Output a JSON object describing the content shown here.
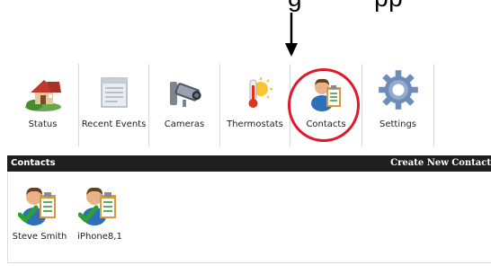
{
  "annotation": {
    "top_text_left": "g",
    "top_text_right": "pp"
  },
  "toolbar": {
    "items": [
      {
        "label": "Status",
        "icon": "house-icon"
      },
      {
        "label": "Recent Events",
        "icon": "document-icon"
      },
      {
        "label": "Cameras",
        "icon": "camera-icon"
      },
      {
        "label": "Thermostats",
        "icon": "thermometer-icon"
      },
      {
        "label": "Contacts",
        "icon": "contact-icon"
      },
      {
        "label": "Settings",
        "icon": "gear-icon"
      }
    ]
  },
  "panel": {
    "title": "Contacts",
    "action": "Create New Contact"
  },
  "contacts": [
    {
      "name": "Steve Smith"
    },
    {
      "name": "iPhone8,1"
    }
  ],
  "colors": {
    "highlight": "#e0192a",
    "panel_bar": "#1f1f1f"
  }
}
